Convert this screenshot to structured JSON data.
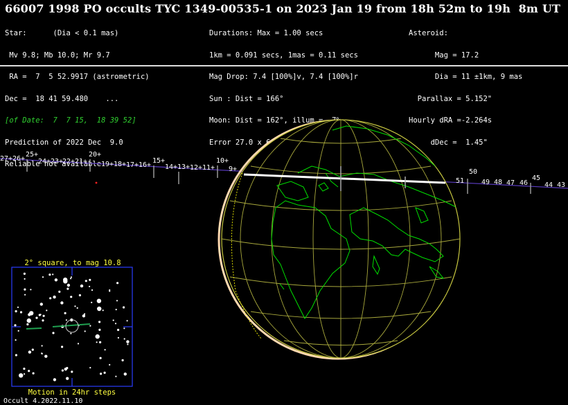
{
  "title": "66007 1998 PO occults TYC 1349-00535-1 on 2023 Jan 19 from 18h 52m to 19h  8m UT",
  "star": [
    "Star:      (Dia < 0.1 mas)",
    " Mv 9.8; Mb 10.0; Mr 9.7",
    " RA =  7  5 52.9917 (astrometric)",
    "Dec =  18 41 59.480    ...",
    "[of Date:  7  7 15,  18 39 52]",
    "Prediction of 2022 Dec  9.0",
    "Reliable not available"
  ],
  "event": [
    "Durations: Max = 1.00 secs",
    "1km = 0.091 secs, 1mas = 0.11 secs",
    "Mag Drop: 7.4 [100%]v, 7.4 [100%]r",
    "Sun : Dist = 166°",
    "Moon: Dist = 162°, illum =  7%",
    "Error 27.0 x 6.0 mas in PA 102°"
  ],
  "asteroid": [
    "Asteroid:",
    "      Mag = 17.2",
    "      Dia = 11 ±1km, 9 mas",
    "  Parallax = 5.152\"",
    "Hourly dRA =-2.264s",
    "     dDec =  1.45\""
  ],
  "path_ticks_left": [
    {
      "label": "27+",
      "minute": 27
    },
    {
      "label": "26+",
      "minute": 26
    },
    {
      "label": "25+",
      "minute": 25
    },
    {
      "label": "24+",
      "minute": 24
    },
    {
      "label": "23+",
      "minute": 23
    },
    {
      "label": "22+",
      "minute": 22
    },
    {
      "label": "21+",
      "minute": 21
    },
    {
      "label": "20+",
      "minute": 20
    },
    {
      "label": "19+",
      "minute": 19
    },
    {
      "label": "18+",
      "minute": 18
    },
    {
      "label": "17+",
      "minute": 17
    },
    {
      "label": "16+",
      "minute": 16
    },
    {
      "label": "15+",
      "minute": 15
    },
    {
      "label": "14+",
      "minute": 14
    },
    {
      "label": "13+",
      "minute": 13
    },
    {
      "label": "12+",
      "minute": 12
    },
    {
      "label": "11+",
      "minute": 11
    },
    {
      "label": "10+",
      "minute": 10
    },
    {
      "label": "9+",
      "minute": 9
    }
  ],
  "path_ticks_right": [
    {
      "label": "50",
      "minute": 50
    },
    {
      "label": "51",
      "minute": 51
    },
    {
      "label": "49",
      "minute": 49
    },
    {
      "label": "48",
      "minute": 48
    },
    {
      "label": "47",
      "minute": 47
    },
    {
      "label": "46",
      "minute": 46
    },
    {
      "label": "45",
      "minute": 45
    },
    {
      "label": "44",
      "minute": 44
    },
    {
      "label": "43",
      "minute": 43
    }
  ],
  "starchart": {
    "caption_top": "2° square, to mag 10.8",
    "caption_bottom": "Motion in 24hr steps"
  },
  "footer": "Occult 4.2022.11.10",
  "colors": {
    "continents": "#00e000",
    "graticule": "#b0b040",
    "path": "#ffffff",
    "track": "#6040c0",
    "chart_frame": "#3040ff",
    "caption": "#ffff40"
  }
}
